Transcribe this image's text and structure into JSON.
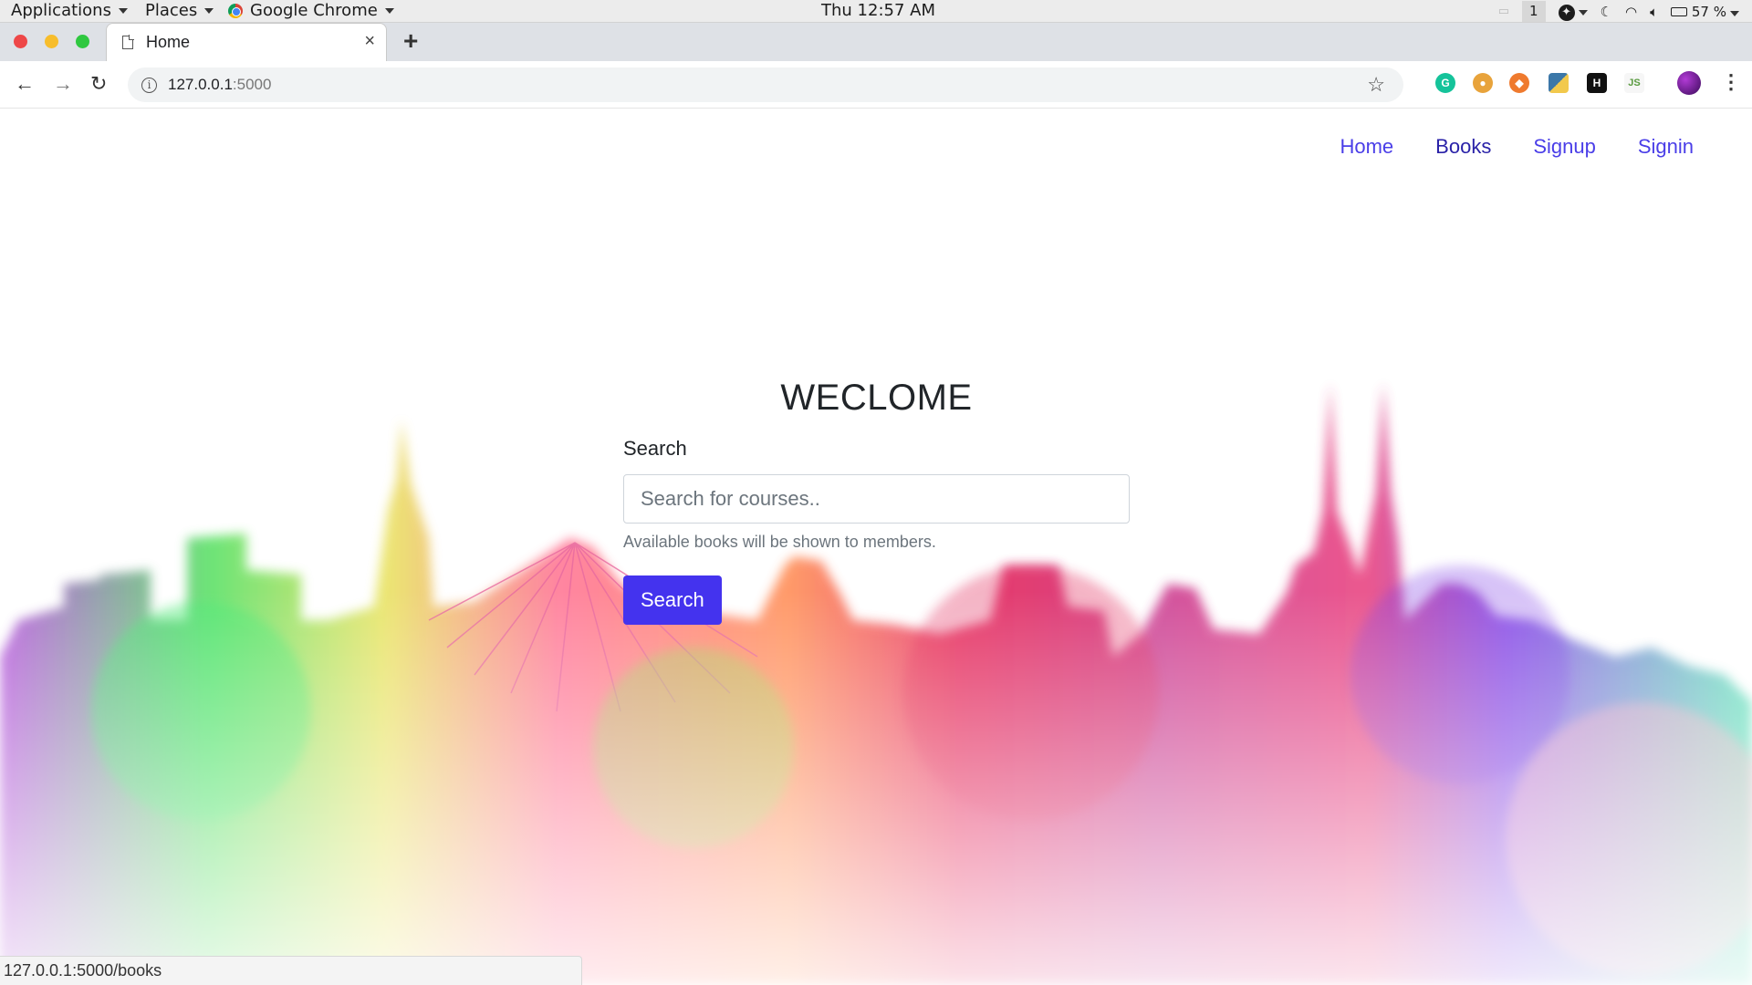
{
  "system_bar": {
    "applications_label": "Applications",
    "places_label": "Places",
    "browser_label": "Google Chrome",
    "clock": "Thu 12:57 AM",
    "workspace": "1",
    "battery": "57 %"
  },
  "browser": {
    "tab_title": "Home",
    "close_glyph": "×",
    "new_tab_glyph": "+",
    "url_host": "127.0.0.1",
    "url_port": ":5000",
    "status_url": "127.0.0.1:5000/books",
    "extensions": [
      "grammarly-icon",
      "cookie-icon",
      "fox-icon",
      "python-icon",
      "h-icon",
      "js-icon",
      "profile-avatar"
    ]
  },
  "site": {
    "nav": [
      {
        "label": "Home"
      },
      {
        "label": "Books"
      },
      {
        "label": "Signup"
      },
      {
        "label": "Signin"
      }
    ],
    "heading": "WECLOME",
    "search_label": "Search",
    "search_placeholder": "Search for courses..",
    "help_text": "Available books will be shown to members.",
    "search_button": "Search"
  },
  "colors": {
    "link": "#4a3ee8",
    "button": "#4433ee"
  }
}
